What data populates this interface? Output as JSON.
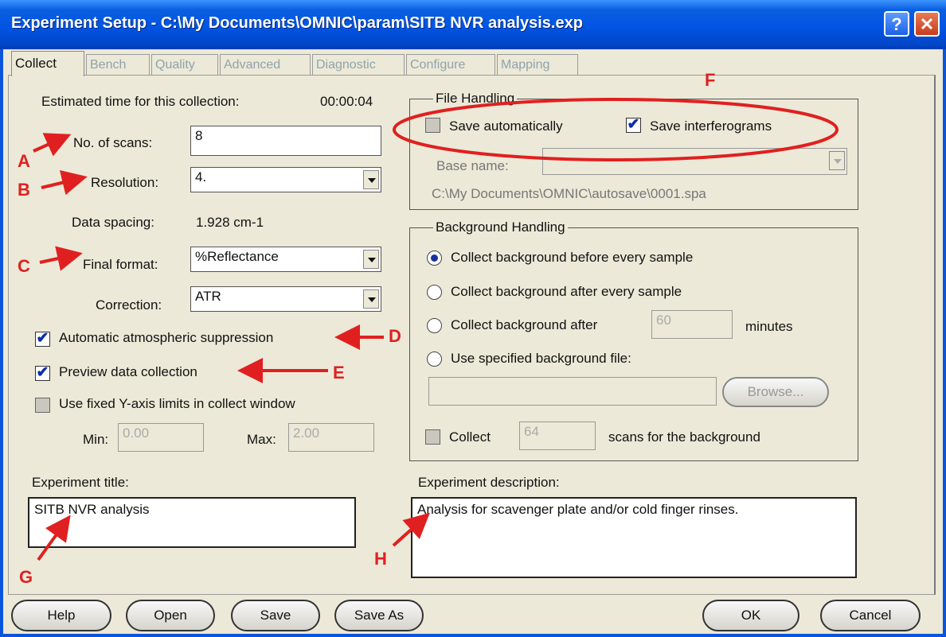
{
  "window": {
    "title": "Experiment Setup - C:\\My Documents\\OMNIC\\param\\SITB NVR analysis.exp",
    "help_glyph": "?",
    "close_glyph": "✕"
  },
  "tabs": [
    {
      "label": "Collect",
      "active": true
    },
    {
      "label": "Bench"
    },
    {
      "label": "Quality"
    },
    {
      "label": "Advanced"
    },
    {
      "label": "Diagnostic"
    },
    {
      "label": "Configure"
    },
    {
      "label": "Mapping"
    }
  ],
  "collect": {
    "estimated_time_label": "Estimated time for this collection:",
    "estimated_time_value": "00:00:04",
    "scans_label": "No. of scans:",
    "scans_value": "8",
    "resolution_label": "Resolution:",
    "resolution_value": "4.",
    "data_spacing_label": "Data spacing:",
    "data_spacing_value": "1.928 cm-1",
    "final_format_label": "Final format:",
    "final_format_value": "%Reflectance",
    "correction_label": "Correction:",
    "correction_value": "ATR",
    "atmos_label": "Automatic atmospheric suppression",
    "atmos_checked": true,
    "preview_label": "Preview data collection",
    "preview_checked": true,
    "fixed_y_label": "Use fixed Y-axis limits in collect window",
    "fixed_y_checked": false,
    "min_label": "Min:",
    "min_value": "0.00",
    "max_label": "Max:",
    "max_value": "2.00",
    "exp_title_label": "Experiment title:",
    "exp_title_value": "SITB NVR analysis",
    "exp_desc_label": "Experiment description:",
    "exp_desc_value": "Analysis for scavenger plate and/or cold finger rinses."
  },
  "file_handling": {
    "legend": "File Handling",
    "save_auto_label": "Save automatically",
    "save_auto_checked": false,
    "save_igram_label": "Save interferograms",
    "save_igram_checked": true,
    "base_name_label": "Base name:",
    "base_name_value": "",
    "path": "C:\\My Documents\\OMNIC\\autosave\\0001.spa"
  },
  "background": {
    "legend": "Background Handling",
    "options": [
      {
        "label": "Collect background before every sample",
        "selected": true
      },
      {
        "label": "Collect background after every sample",
        "selected": false
      },
      {
        "label": "Collect background after",
        "selected": false
      },
      {
        "label": "Use specified background file:",
        "selected": false
      }
    ],
    "after_minutes_value": "60",
    "minutes_label": "minutes",
    "file_value": "",
    "browse_label": "Browse...",
    "collect_label": "Collect",
    "collect_checked": false,
    "collect_scans_value": "64",
    "scans_for_bg_label": "scans for the background"
  },
  "buttons": {
    "help": "Help",
    "open": "Open",
    "save": "Save",
    "save_as": "Save As",
    "ok": "OK",
    "cancel": "Cancel"
  },
  "annotations": {
    "A": "A",
    "B": "B",
    "C": "C",
    "D": "D",
    "E": "E",
    "F": "F",
    "G": "G",
    "H": "H",
    "color": "#e02020"
  }
}
